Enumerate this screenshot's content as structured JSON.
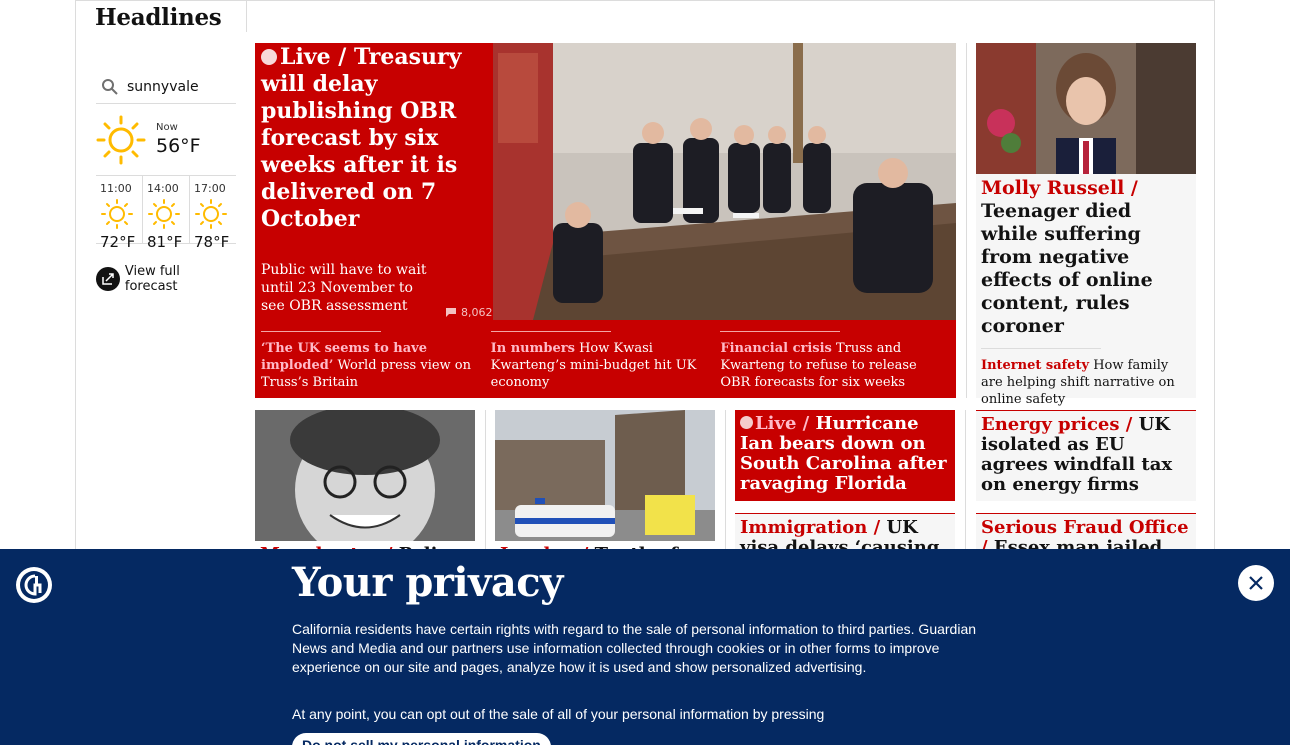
{
  "section": {
    "title": "Headlines"
  },
  "weather": {
    "location": "sunnyvale",
    "now_label": "Now",
    "now_temp": "56°F",
    "forecast": [
      {
        "time": "11:00",
        "temp": "72°F"
      },
      {
        "time": "14:00",
        "temp": "81°F"
      },
      {
        "time": "17:00",
        "temp": "78°F"
      }
    ],
    "full_forecast_label": "View full forecast"
  },
  "lead": {
    "kicker": "Live /",
    "headline": "Treasury will delay publishing OBR forecast by six weeks after it is delivered on 7 October",
    "standfirst": "Public will have to wait until 23 November to see OBR assessment",
    "comments": "8,062",
    "sublinks": [
      {
        "kicker": "‘The UK seems to have imploded’",
        "text": "World press view on Truss’s Britain"
      },
      {
        "kicker": "In numbers",
        "text": "How Kwasi Kwarteng’s mini-budget hit UK economy"
      },
      {
        "kicker": "Financial crisis",
        "text": "Truss and Kwarteng to refuse to release OBR forecasts for six weeks"
      }
    ]
  },
  "right_card": {
    "kicker": "Molly Russell /",
    "headline": "Teenager died while suffering from negative effects of online content, rules coroner",
    "sub_kicker": "Internet safety",
    "sub_text": "How family are helping shift narrative on online safety"
  },
  "row2": {
    "card1": {
      "kicker": "Manchester /",
      "headline": "Police"
    },
    "card2": {
      "kicker": "London /",
      "headline": "Tenth of"
    },
    "card3": {
      "kicker": "Live /",
      "headline": "Hurricane Ian bears down on South Carolina after ravaging Florida"
    },
    "card4": {
      "kicker": "Energy prices /",
      "headline": "UK isolated as EU agrees windfall tax on energy firms"
    },
    "card5": {
      "kicker": "Immigration /",
      "headline": "UK visa delays ‘causing rent"
    },
    "card6": {
      "kicker": "Serious Fraud Office /",
      "headline": "Essex man jailed over"
    }
  },
  "privacy": {
    "title": "Your privacy",
    "body": "California residents have certain rights with regard to the sale of personal information to third parties. Guardian News and Media and our partners use information collected through cookies or in other forms to improve experience on our site and pages, analyze how it is used and show personalized advertising.",
    "body2": "At any point, you can opt out of the sale of all of your personal information by pressing",
    "button": "Do not sell my personal information"
  },
  "colors": {
    "red": "#c70000",
    "navy": "#052962",
    "sun": "#ffbb00"
  }
}
